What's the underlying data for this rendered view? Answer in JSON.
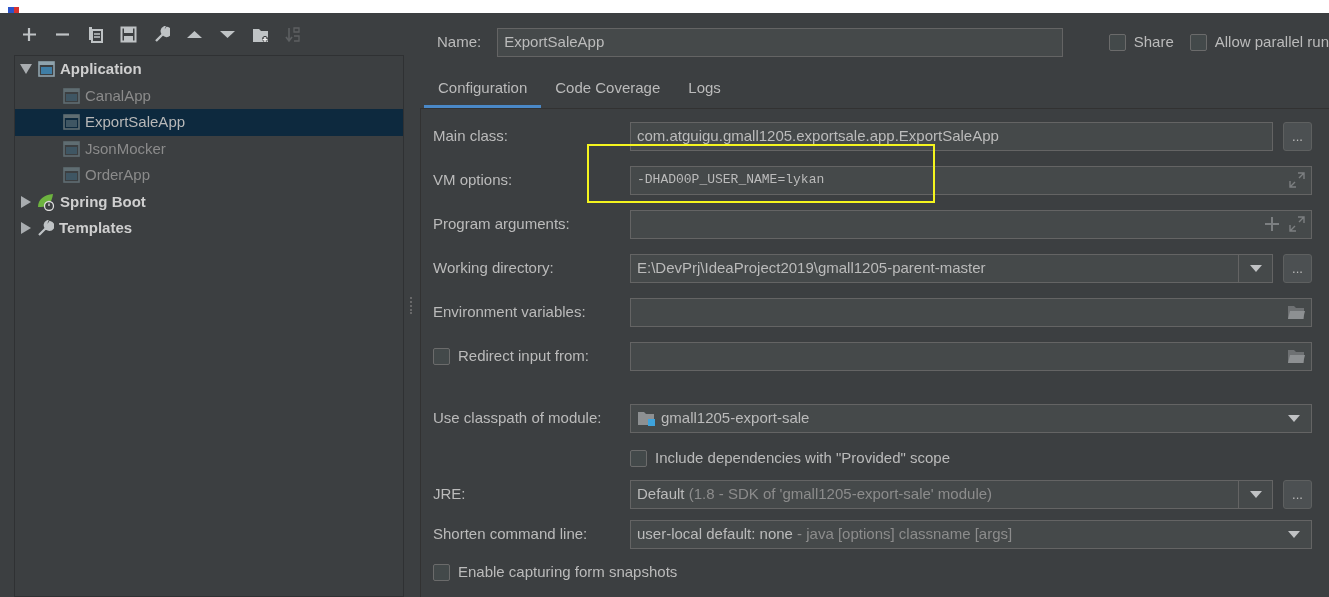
{
  "toolbar": [
    {
      "kind": "add",
      "disabled": false
    },
    {
      "kind": "remove",
      "disabled": false
    },
    {
      "kind": "copy",
      "disabled": false
    },
    {
      "kind": "save",
      "disabled": false
    },
    {
      "kind": "edit-defaults",
      "disabled": false
    },
    {
      "kind": "up",
      "disabled": false
    },
    {
      "kind": "down",
      "disabled": false
    },
    {
      "kind": "folder",
      "disabled": false
    },
    {
      "kind": "sort",
      "disabled": true
    }
  ],
  "tree": [
    {
      "kind": "application",
      "label": "Application",
      "expanded": true,
      "children": [
        {
          "label": "CanalApp",
          "selected": false
        },
        {
          "label": "ExportSaleApp",
          "selected": true
        },
        {
          "label": "JsonMocker",
          "selected": false
        },
        {
          "label": "OrderApp",
          "selected": false
        }
      ]
    },
    {
      "kind": "spring-boot",
      "label": "Spring Boot",
      "expanded": false
    },
    {
      "kind": "templates",
      "label": "Templates",
      "expanded": false
    }
  ],
  "name": {
    "label": "Name:",
    "value": "ExportSaleApp"
  },
  "options": [
    {
      "label": "Share",
      "checked": false
    },
    {
      "label": "Allow parallel run",
      "checked": false
    }
  ],
  "tabs": [
    {
      "label": "Configuration",
      "selected": true
    },
    {
      "label": "Code Coverage",
      "selected": false
    },
    {
      "label": "Logs",
      "selected": false
    }
  ],
  "fields": [
    {
      "kind": "class",
      "label": "Main class:",
      "value": "com.atguigu.gmall1205.exportsale.app.ExportSaleApp",
      "browse": "..."
    },
    {
      "kind": "vm",
      "label": "VM options:",
      "value": "-DHAD00P_USER_NAME=lykan",
      "highlighted": true
    },
    {
      "kind": "args",
      "label": "Program arguments:"
    },
    {
      "kind": "dir",
      "label": "Working directory:",
      "value": "E:\\DevPrj\\IdeaProject2019\\gmall1205-parent-master",
      "browse": "..."
    },
    {
      "kind": "env",
      "label": "Environment variables:"
    },
    {
      "kind": "redirect",
      "label": "Redirect input from:",
      "checked": false
    },
    {
      "kind": "module",
      "label": "Use classpath of module:",
      "value": "gmall1205-export-sale"
    },
    {
      "kind": "include",
      "label": "Include dependencies with \"Provided\" scope",
      "checked": false
    },
    {
      "kind": "jre",
      "label": "JRE:",
      "value": "Default",
      "detail": "(1.8 - SDK of 'gmall1205-export-sale' module)",
      "browse": "..."
    },
    {
      "kind": "shorten",
      "label": "Shorten command line:",
      "value": "user-local default: none",
      "detail": "- java [options] classname [args]"
    },
    {
      "kind": "capture",
      "label": "Enable capturing form snapshots",
      "checked": false
    }
  ]
}
